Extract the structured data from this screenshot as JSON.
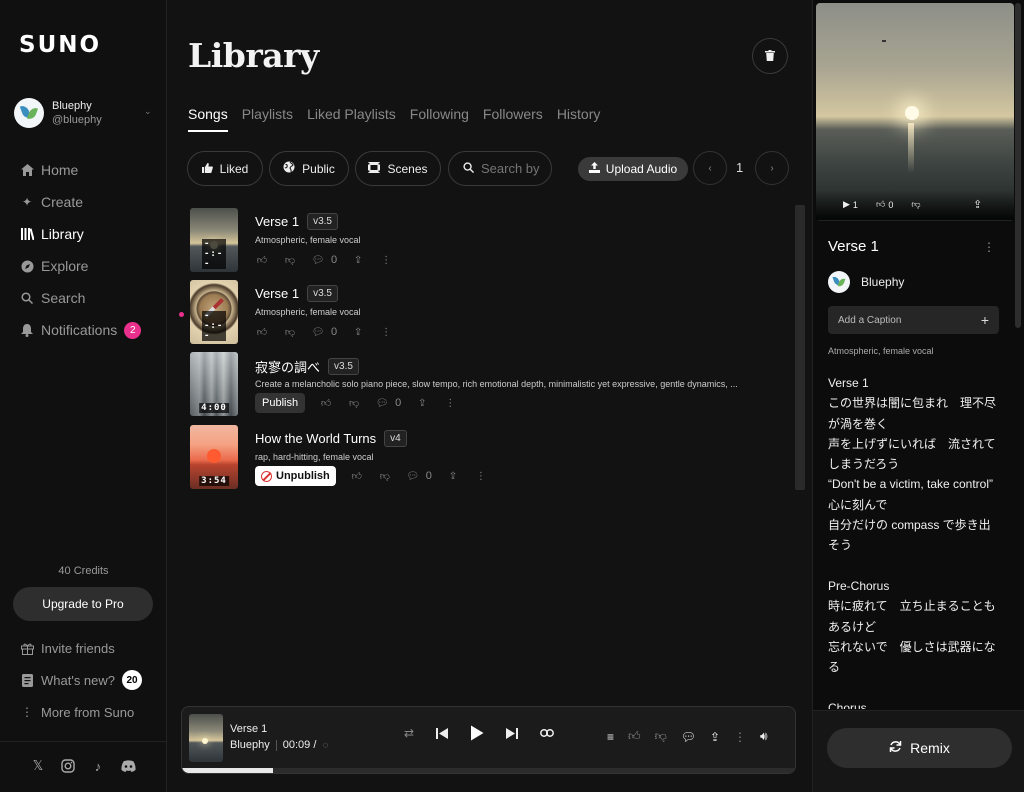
{
  "brand": "SUNO",
  "user": {
    "name": "Bluephy",
    "handle": "@bluephy"
  },
  "nav": [
    {
      "label": "Home",
      "icon": "home-icon"
    },
    {
      "label": "Create",
      "icon": "create-icon"
    },
    {
      "label": "Library",
      "icon": "library-icon"
    },
    {
      "label": "Explore",
      "icon": "explore-icon"
    },
    {
      "label": "Search",
      "icon": "search-icon"
    },
    {
      "label": "Notifications",
      "icon": "bell-icon",
      "badge": "2"
    }
  ],
  "credits": "40 Credits",
  "upgrade_label": "Upgrade to Pro",
  "nav2": [
    {
      "label": "Invite friends",
      "icon": "gift-icon"
    },
    {
      "label": "What's new?",
      "icon": "document-icon",
      "badge": "20"
    },
    {
      "label": "More from Suno",
      "icon": "kebab-icon"
    }
  ],
  "main": {
    "title": "Library",
    "tabs": [
      "Songs",
      "Playlists",
      "Liked Playlists",
      "Following",
      "Followers",
      "History"
    ],
    "filters": {
      "liked": "Liked",
      "public": "Public",
      "scenes": "Scenes",
      "search_placeholder": "Search by",
      "upload": "Upload Audio",
      "page": "1"
    },
    "songs": [
      {
        "title": "Verse 1",
        "version": "v3.5",
        "desc": "Atmospheric, female vocal",
        "duration": "--:--",
        "comments": "0"
      },
      {
        "title": "Verse 1",
        "version": "v3.5",
        "desc": "Atmospheric, female vocal",
        "duration": "--:--",
        "comments": "0"
      },
      {
        "title": "寂寥の調べ",
        "version": "v3.5",
        "desc": "Create a melancholic solo piano piece, slow tempo, rich emotional depth, minimalistic yet expressive, gentle dynamics, ...",
        "duration": "4:00",
        "comments": "0",
        "action": "Publish"
      },
      {
        "title": "How the World Turns",
        "version": "v4",
        "desc": "rap, hard-hitting, female vocal",
        "duration": "3:54",
        "comments": "0",
        "action": "Unpublish"
      }
    ]
  },
  "player": {
    "title": "Verse 1",
    "artist": "Bluephy",
    "time": "00:09 /",
    "progress": 0.148
  },
  "panel": {
    "plays": "1",
    "likes": "0",
    "title": "Verse 1",
    "author": "Bluephy",
    "caption_placeholder": "Add a Caption",
    "style": "Atmospheric, female vocal",
    "lyrics": "Verse 1\nこの世界は闇に包まれ　理不尽が渦を巻く\n声を上げずにいれば　流されてしまうだろう\n“Don't be a victim, take control” 心に刻んで\n自分だけの compass で歩き出そう\n\nPre-Chorus\n時に疲れて　立ち止まることもあるけど\n忘れないで　優しさは武器になる\n\nChorus",
    "remix": "Remix"
  }
}
